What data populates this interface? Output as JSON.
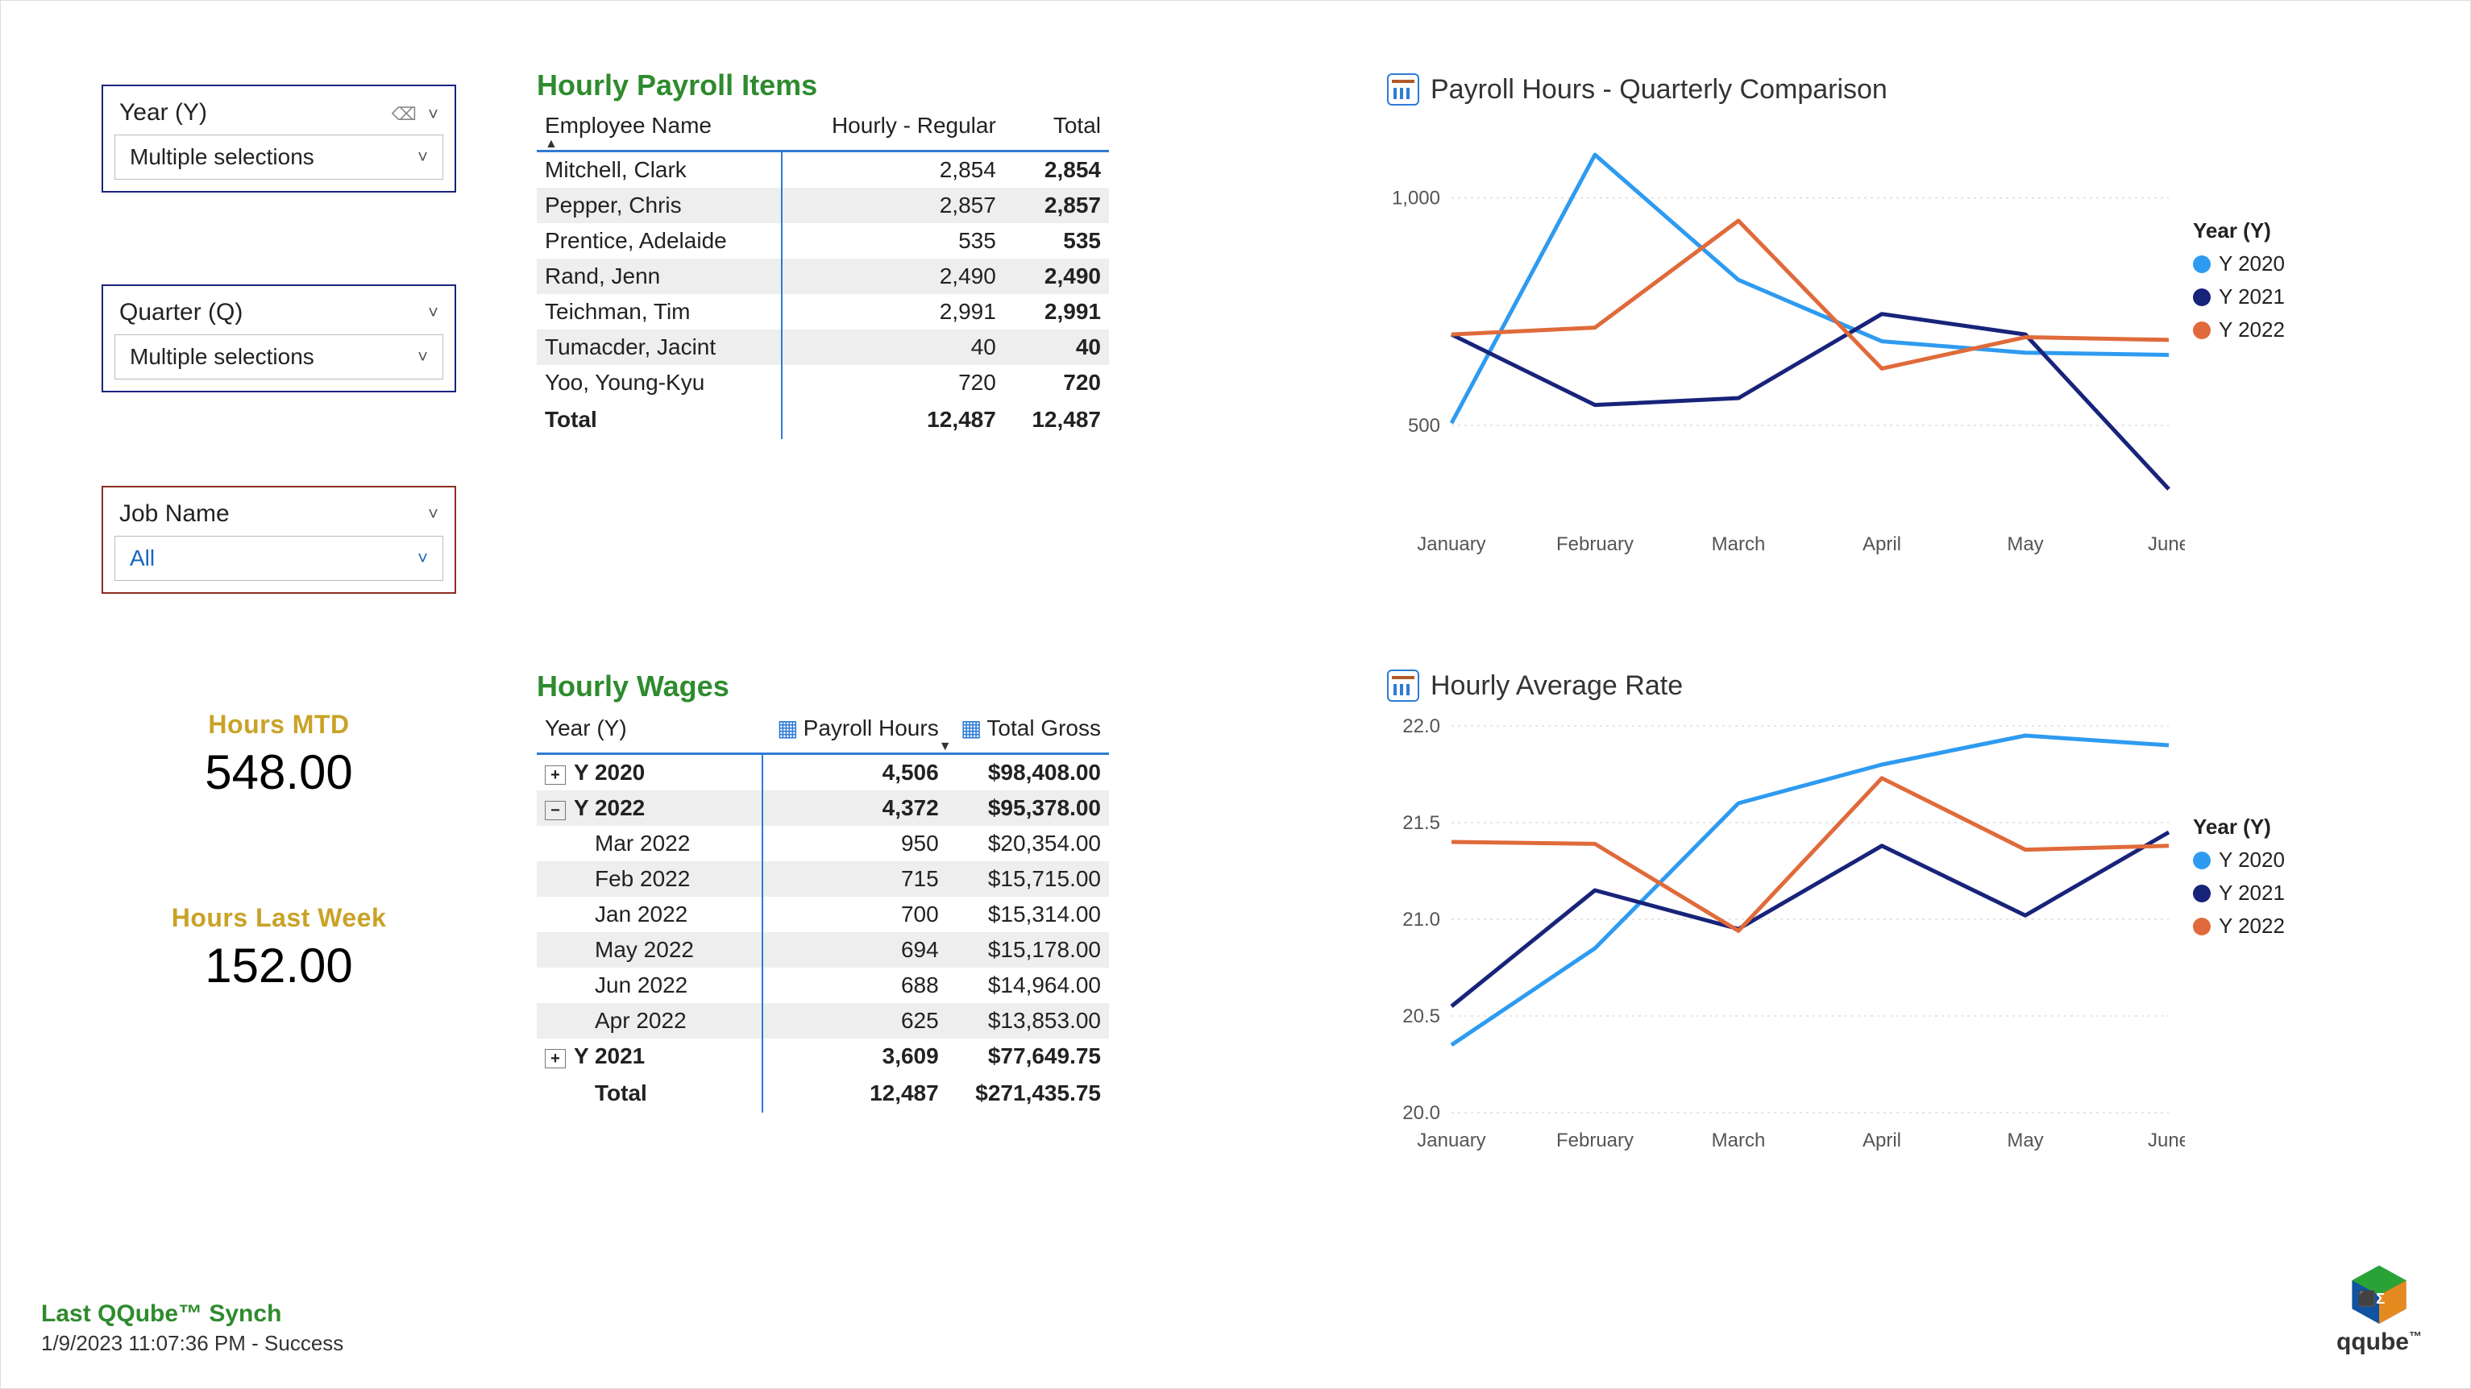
{
  "slicers": {
    "year": {
      "label": "Year (Y)",
      "value": "Multiple selections"
    },
    "quarter": {
      "label": "Quarter (Q)",
      "value": "Multiple selections"
    },
    "job": {
      "label": "Job Name",
      "value": "All"
    }
  },
  "kpis": {
    "mtd": {
      "label": "Hours MTD",
      "value": "548.00"
    },
    "last": {
      "label": "Hours Last Week",
      "value": "152.00"
    }
  },
  "section_titles": {
    "t1": "Hourly Payroll Items",
    "t2": "Hourly Wages"
  },
  "tbl1": {
    "cols": [
      "Employee Name",
      "Hourly - Regular",
      "Total"
    ],
    "rows": [
      [
        "Mitchell, Clark",
        "2,854",
        "2,854"
      ],
      [
        "Pepper, Chris",
        "2,857",
        "2,857"
      ],
      [
        "Prentice, Adelaide",
        "535",
        "535"
      ],
      [
        "Rand, Jenn",
        "2,490",
        "2,490"
      ],
      [
        "Teichman, Tim",
        "2,991",
        "2,991"
      ],
      [
        "Tumacder, Jacint",
        "40",
        "40"
      ],
      [
        "Yoo, Young-Kyu",
        "720",
        "720"
      ]
    ],
    "total_label": "Total",
    "totals": [
      "12,487",
      "12,487"
    ]
  },
  "tbl2": {
    "cols": [
      "Year (Y)",
      "Payroll Hours",
      "Total Gross"
    ],
    "rows": [
      {
        "type": "year",
        "toggle": "plus",
        "label": "Y 2020",
        "hours": "4,506",
        "gross": "$98,408.00",
        "shade": false
      },
      {
        "type": "year",
        "toggle": "minus",
        "label": "Y 2022",
        "hours": "4,372",
        "gross": "$95,378.00",
        "shade": true
      },
      {
        "type": "month",
        "label": "Mar 2022",
        "hours": "950",
        "gross": "$20,354.00",
        "shade": false
      },
      {
        "type": "month",
        "label": "Feb 2022",
        "hours": "715",
        "gross": "$15,715.00",
        "shade": true
      },
      {
        "type": "month",
        "label": "Jan 2022",
        "hours": "700",
        "gross": "$15,314.00",
        "shade": false
      },
      {
        "type": "month",
        "label": "May 2022",
        "hours": "694",
        "gross": "$15,178.00",
        "shade": true
      },
      {
        "type": "month",
        "label": "Jun 2022",
        "hours": "688",
        "gross": "$14,964.00",
        "shade": false
      },
      {
        "type": "month",
        "label": "Apr 2022",
        "hours": "625",
        "gross": "$13,853.00",
        "shade": true
      },
      {
        "type": "year",
        "toggle": "plus",
        "label": "Y 2021",
        "hours": "3,609",
        "gross": "$77,649.75",
        "shade": false
      }
    ],
    "total_label": "Total",
    "totals": [
      "12,487",
      "$271,435.75"
    ]
  },
  "chart1": {
    "title": "Payroll Hours - Quarterly Comparison",
    "legend_title": "Year (Y)",
    "legend": [
      "Y 2020",
      "Y 2021",
      "Y 2022"
    ]
  },
  "chart2": {
    "title": "Hourly Average Rate",
    "legend_title": "Year (Y)",
    "legend": [
      "Y 2020",
      "Y 2021",
      "Y 2022"
    ]
  },
  "chart_data": [
    {
      "type": "line",
      "title": "Payroll Hours - Quarterly Comparison",
      "xlabel": "",
      "ylabel": "",
      "categories": [
        "January",
        "February",
        "March",
        "April",
        "May",
        "June"
      ],
      "y_ticks": [
        500,
        1000
      ],
      "ylim": [
        300,
        1150
      ],
      "series": [
        {
          "name": "Y 2020",
          "color": "#2e9bf0",
          "values": [
            505,
            1095,
            820,
            685,
            660,
            655
          ]
        },
        {
          "name": "Y 2021",
          "color": "#18237a",
          "values": [
            700,
            545,
            560,
            745,
            700,
            360
          ]
        },
        {
          "name": "Y 2022",
          "color": "#e06a3b",
          "values": [
            700,
            715,
            950,
            625,
            694,
            688
          ]
        }
      ]
    },
    {
      "type": "line",
      "title": "Hourly Average Rate",
      "xlabel": "",
      "ylabel": "",
      "categories": [
        "January",
        "February",
        "March",
        "April",
        "May",
        "June"
      ],
      "y_ticks": [
        20.0,
        20.5,
        21.0,
        21.5,
        22.0
      ],
      "ylim": [
        20.0,
        22.0
      ],
      "series": [
        {
          "name": "Y 2020",
          "color": "#2e9bf0",
          "values": [
            20.35,
            20.85,
            21.6,
            21.8,
            21.95,
            21.9
          ]
        },
        {
          "name": "Y 2021",
          "color": "#18237a",
          "values": [
            20.55,
            21.15,
            20.95,
            21.38,
            21.02,
            21.45
          ]
        },
        {
          "name": "Y 2022",
          "color": "#e06a3b",
          "values": [
            21.4,
            21.39,
            20.94,
            21.73,
            21.36,
            21.38
          ]
        }
      ]
    }
  ],
  "footer": {
    "line1": "Last QQube™ Synch",
    "line2": "1/9/2023 11:07:36 PM - Success"
  },
  "logo": {
    "brand": "qqube"
  }
}
